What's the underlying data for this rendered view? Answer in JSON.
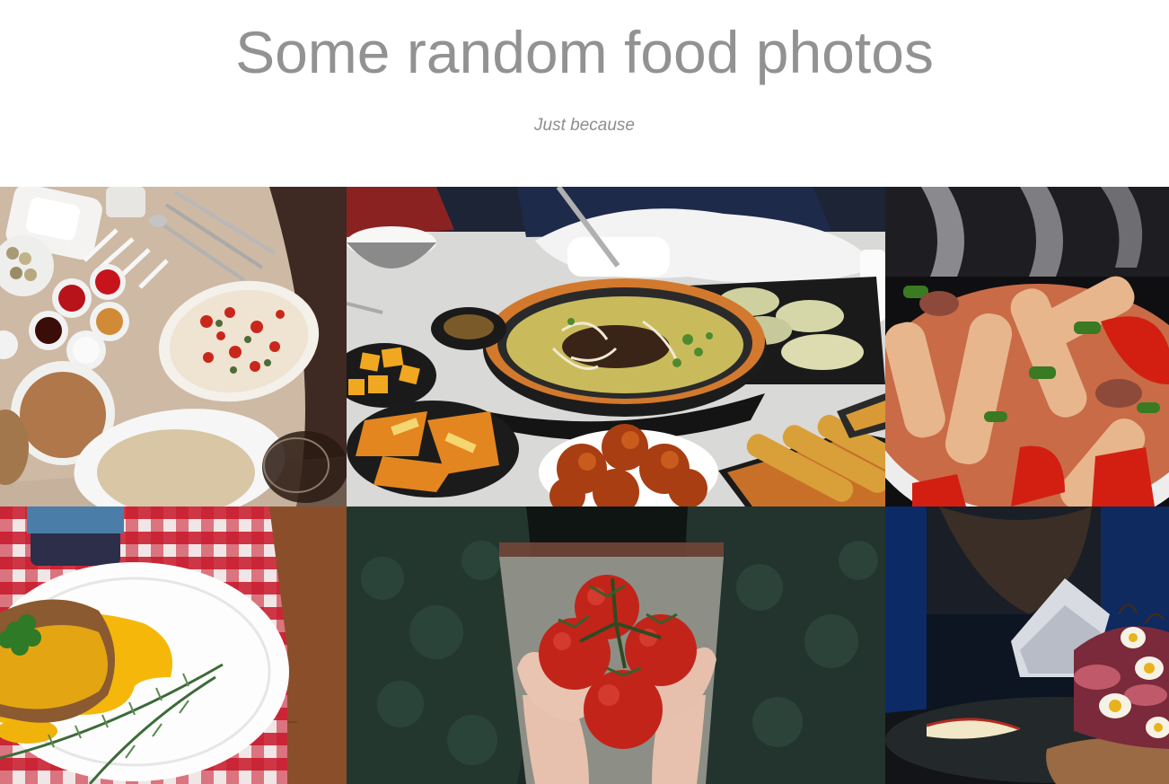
{
  "header": {
    "title": "Some random food photos",
    "subtitle": "Just because"
  },
  "gallery": {
    "photos": [
      {
        "subject": "table spread with dips, spoons, pizza and crepe"
      },
      {
        "subject": "ramen bowl with dumplings, fried chicken and side dishes"
      },
      {
        "subject": "pasta salad close-up with peppers"
      },
      {
        "subject": "plate with sauced meat, parsley and rosemary on checkered cloth"
      },
      {
        "subject": "hands holding tomatoes on the vine"
      },
      {
        "subject": "sandwich with quail eggs on dark table"
      }
    ]
  }
}
